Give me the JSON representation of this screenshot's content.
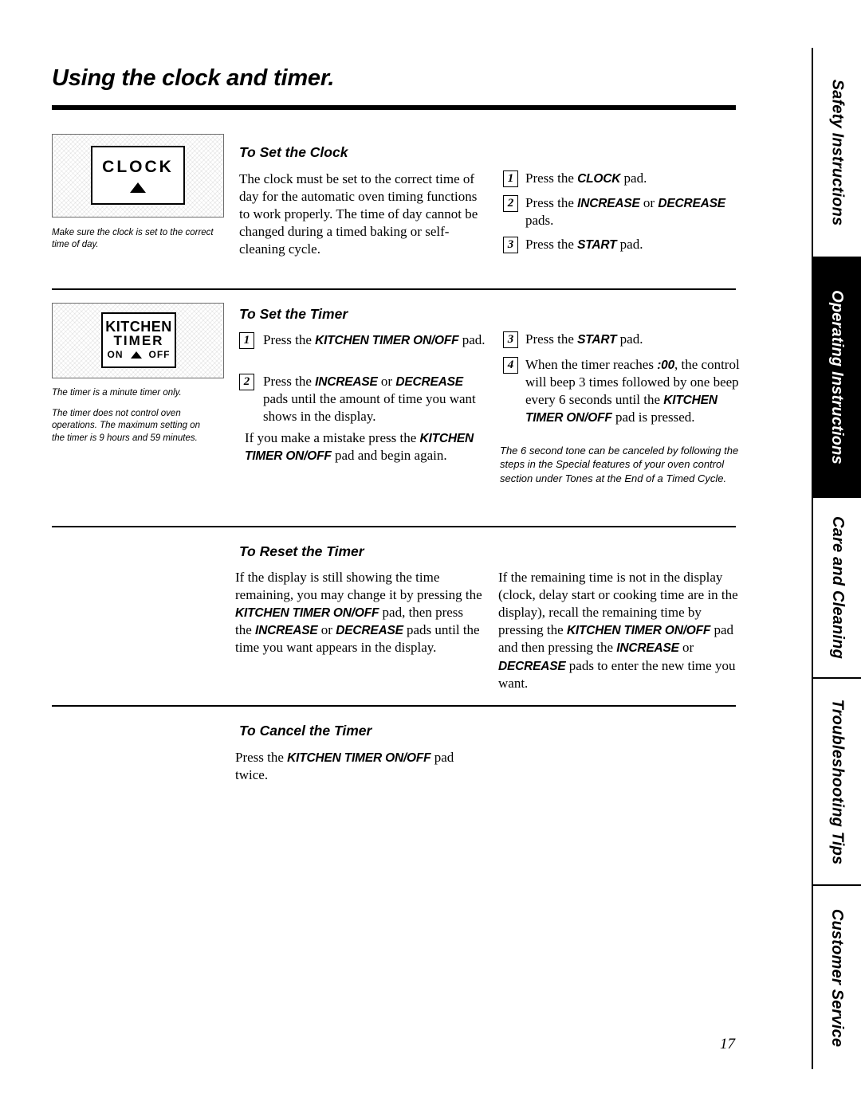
{
  "page": {
    "title": "Using the clock and timer.",
    "number": "17"
  },
  "pads": {
    "clock": {
      "label": "CLOCK",
      "icon": "triangle-up-icon"
    },
    "kitchen_timer": {
      "line1": "KITCHEN",
      "line2": "TIMER",
      "on": "ON",
      "off": "OFF",
      "icon": "triangle-up-icon"
    }
  },
  "notes": {
    "clock_note": "Make sure the clock is set to the correct time of day.",
    "timer_note_1": "The timer is a minute timer only.",
    "timer_note_2": "The timer does not control oven operations. The maximum setting on the timer is 9 hours and 59 minutes."
  },
  "sections": [
    {
      "heading": "To Set the Clock",
      "intro": "The clock must be set to the correct time of day for the automatic oven timing functions to work properly. The time of day cannot be changed during a timed baking or self-cleaning cycle.",
      "steps": [
        {
          "num": "1",
          "text_html": "Press the <b>CLOCK</b> pad."
        },
        {
          "num": "2",
          "text_html": "Press the <b>INCREASE</b> or <b>DECREASE</b> pads."
        },
        {
          "num": "3",
          "text_html": "Press the <b>START</b> pad."
        }
      ]
    },
    {
      "heading": "To Set the Timer",
      "steps_left": [
        {
          "num": "1",
          "text_html": "Press the <b>KITCHEN TIMER ON/OFF</b> pad."
        },
        {
          "num": "2",
          "text_html": "Press the <b>INCREASE</b> or <b>DECREASE</b> pads until the amount of time you want shows in the display."
        }
      ],
      "left_extra_html": "If you make a mistake press the <b>KITCHEN TIMER ON/OFF</b> pad and begin again.",
      "steps_right": [
        {
          "num": "3",
          "text_html": "Press the <b>START</b> pad."
        },
        {
          "num": "4",
          "text_html": "When the timer reaches <b>:00</b>, the control will beep 3 times followed by one beep every 6 seconds until the <b>KITCHEN TIMER ON/OFF</b> pad is pressed."
        }
      ],
      "right_note": "The 6 second tone can be canceled by following the steps in the Special features of your oven control section under Tones at the End of a Timed Cycle."
    },
    {
      "heading": "To Reset the Timer",
      "left_html": "If the display is still showing the time remaining, you may change it by pressing the <b>KITCHEN TIMER ON/OFF</b> pad, then press the <b>INCREASE</b> or <b>DECREASE</b> pads until the time you want appears in the display.",
      "right_html": "If the remaining time is not in the display (clock, delay start or cooking time are in the display), recall the remaining time by pressing the <b>KITCHEN TIMER ON/OFF</b> pad and then pressing the <b>INCREASE</b> or <b>DECREASE</b> pads to enter the new time you want."
    },
    {
      "heading": "To Cancel the Timer",
      "left_html": "Press the <b>KITCHEN TIMER ON/OFF</b> pad twice."
    }
  ],
  "side_tabs": [
    {
      "label": "Safety Instructions",
      "style": "light"
    },
    {
      "label": "Operating Instructions",
      "style": "dark"
    },
    {
      "label": "Care and Cleaning",
      "style": "light"
    },
    {
      "label": "Troubleshooting Tips",
      "style": "light"
    },
    {
      "label": "Customer Service",
      "style": "light"
    }
  ]
}
